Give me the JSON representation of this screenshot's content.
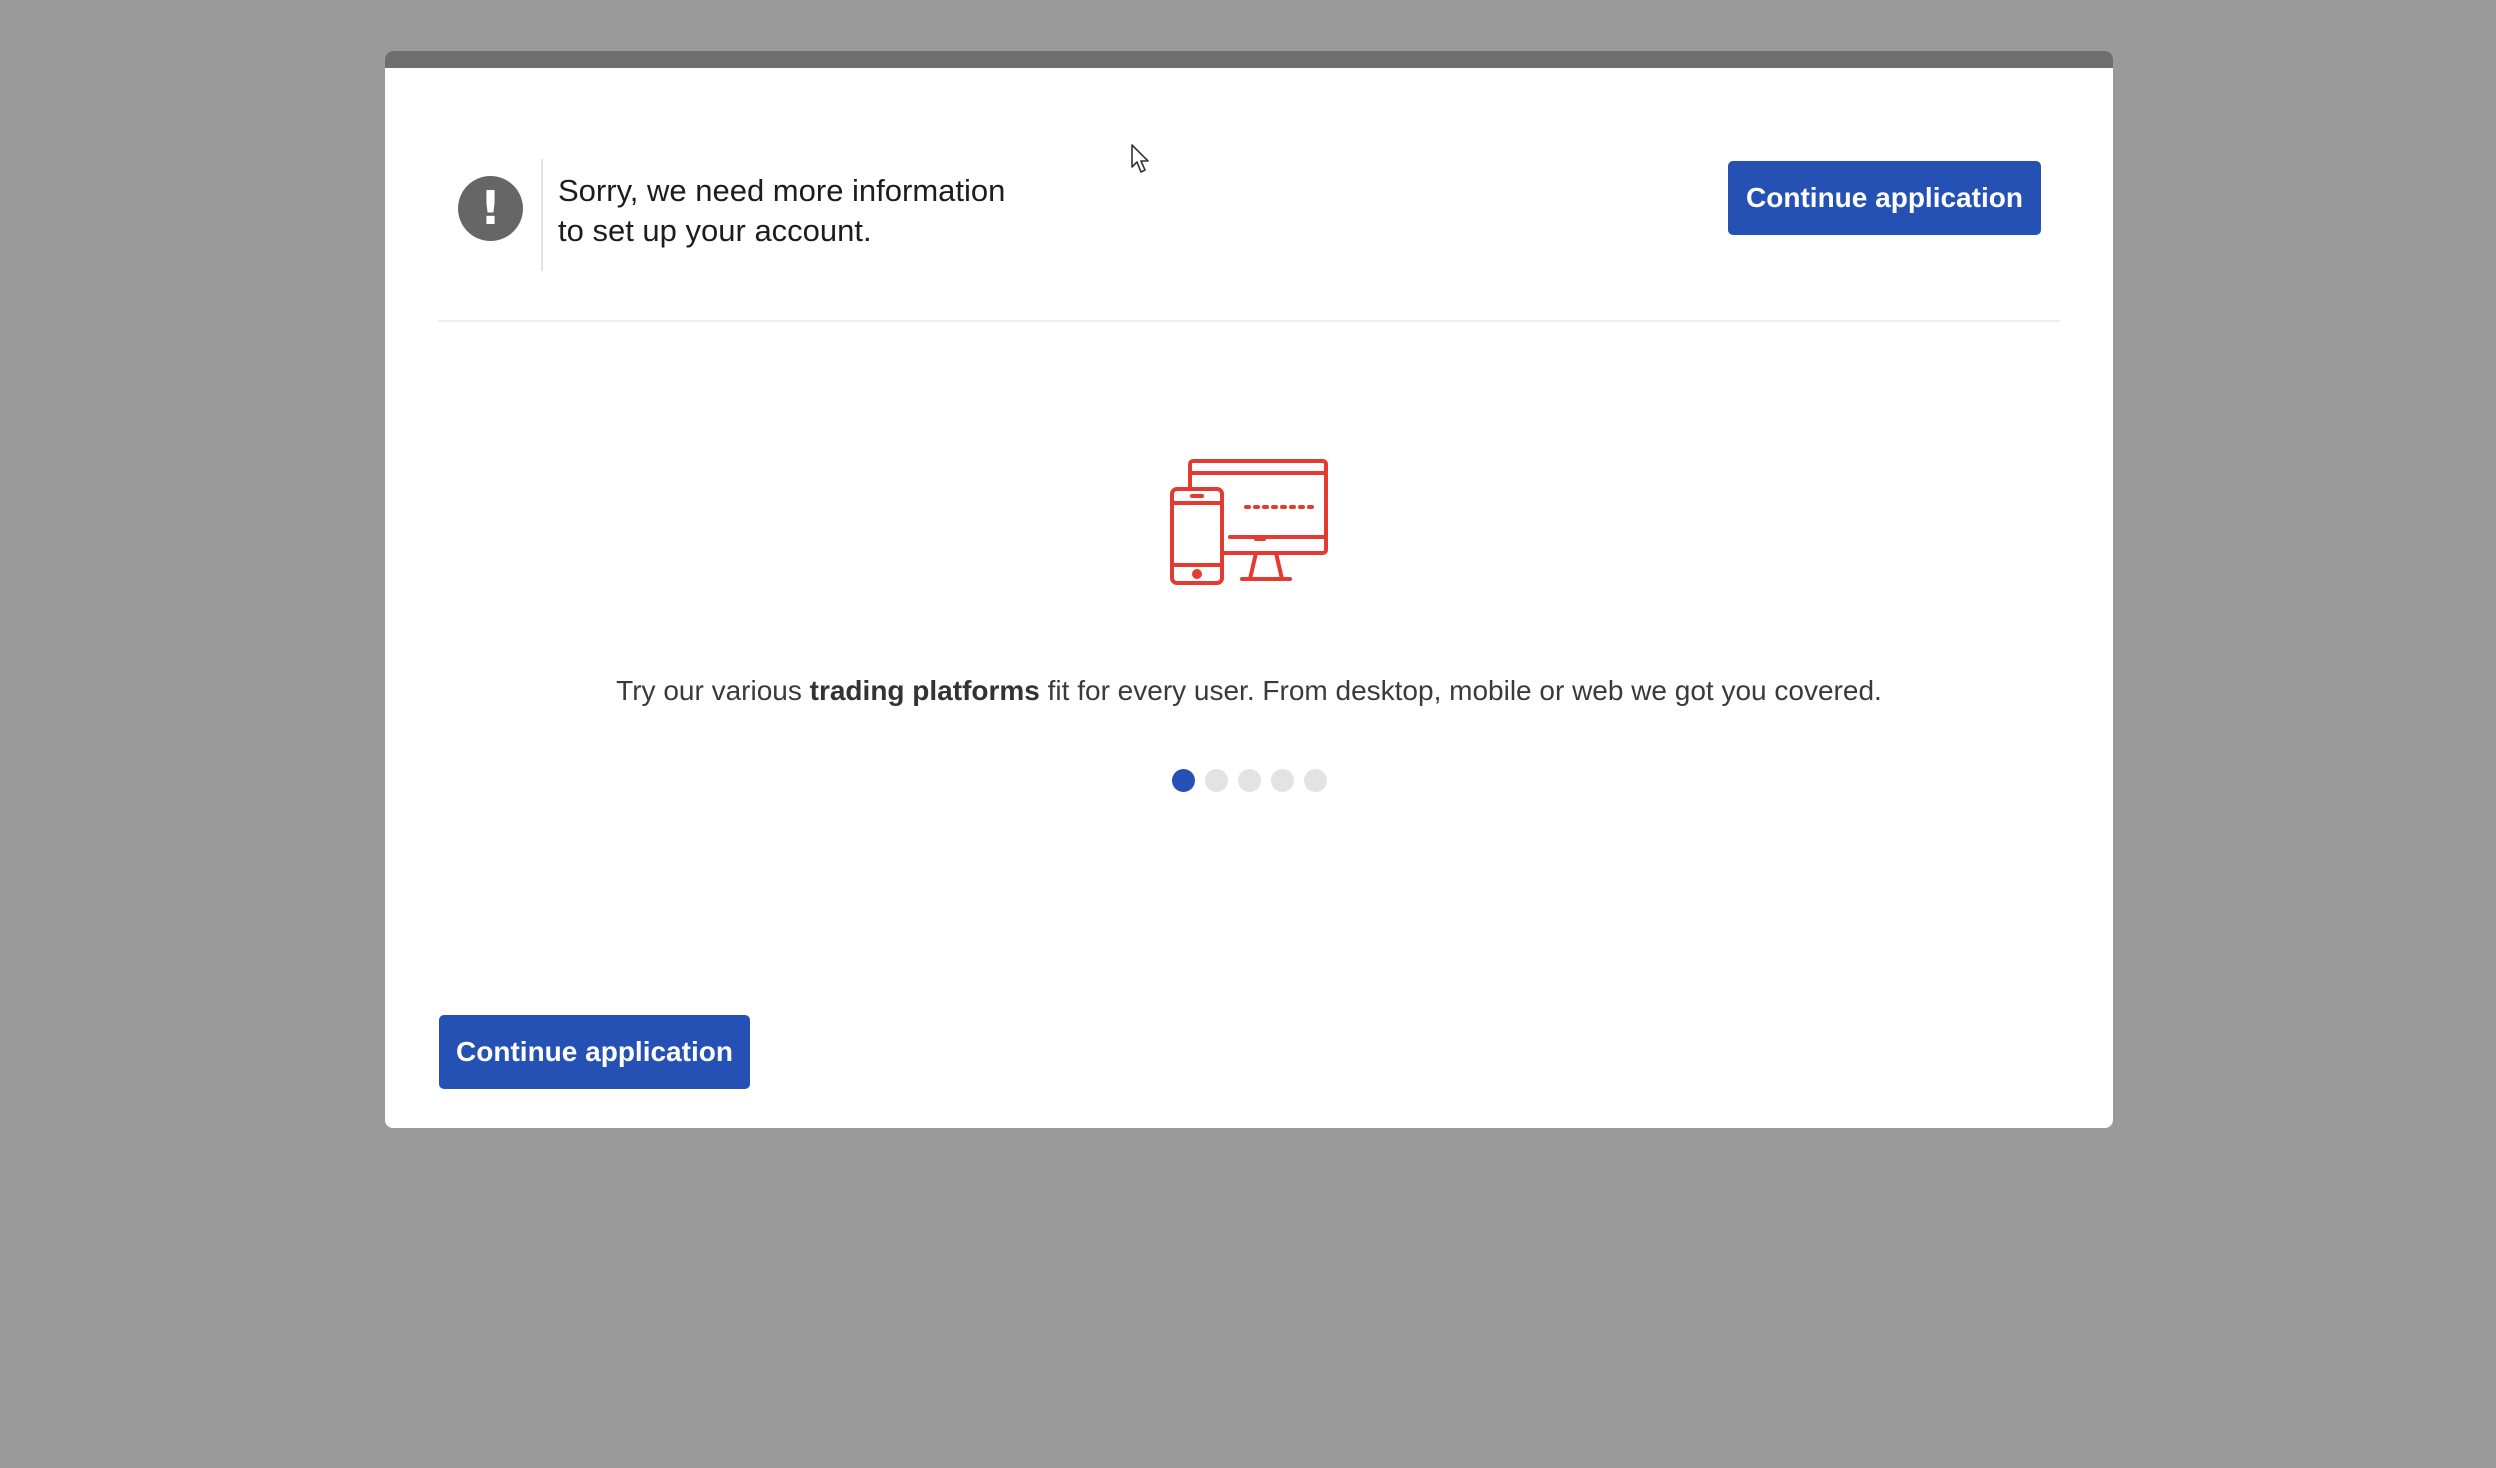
{
  "alert": {
    "icon": "exclamation-icon",
    "message_line1": "Sorry, we need more information",
    "message_line2": "to set up your account."
  },
  "buttons": {
    "continue_top": "Continue application",
    "continue_bottom": "Continue application"
  },
  "carousel": {
    "illustration": "devices-icon",
    "text_before": "Try our various ",
    "text_bold": "trading platforms",
    "text_after": " fit for every user. From desktop, mobile or web we got you covered.",
    "slide_count": 5,
    "active_slide": 1
  },
  "colors": {
    "accent": "#2550b4",
    "illustration": "#e53a2f",
    "backdrop": "#9a9a9a"
  }
}
